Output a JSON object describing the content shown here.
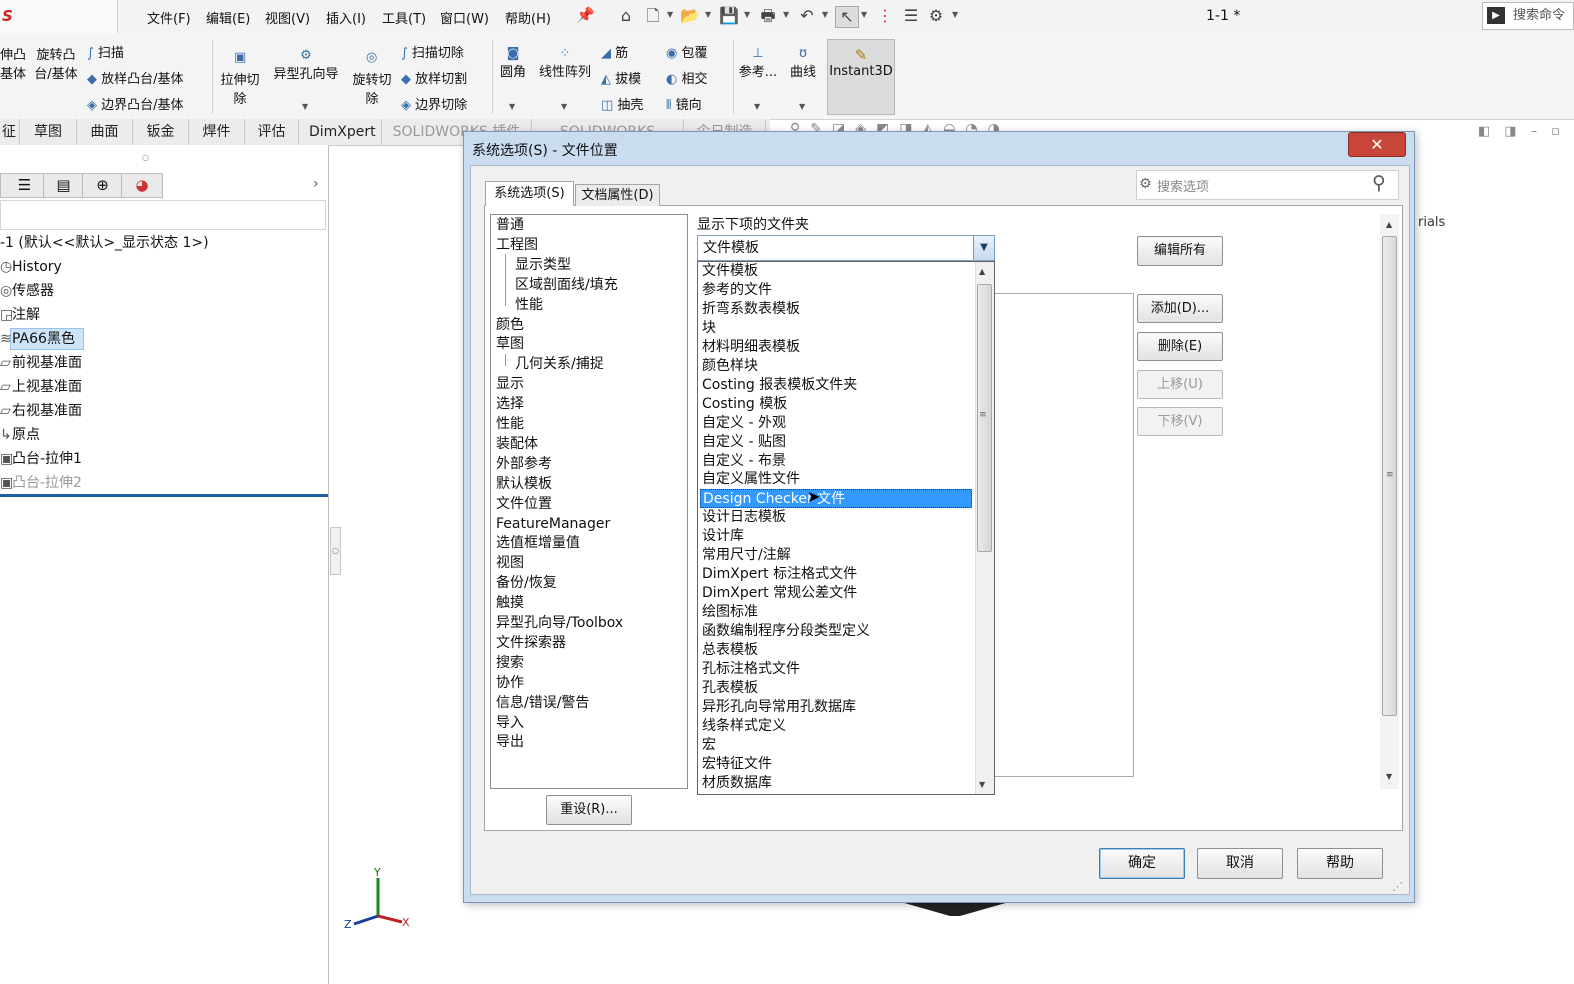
{
  "app": {
    "logo": "S SOLIDWORKS",
    "doc_title": "1-1 *",
    "search_cmd": "搜索命令"
  },
  "menu": [
    "文件(F)",
    "编辑(E)",
    "视图(V)",
    "插入(I)",
    "工具(T)",
    "窗口(W)",
    "帮助(H)"
  ],
  "ribbon": {
    "extrude_boss": "伸凸\n基体",
    "revolve_boss": "旋转凸\n台/基体",
    "sweep": "扫描",
    "loft_boss": "放样凸台/基体",
    "boundary_boss": "边界凸台/基体",
    "extruded_cut": "拉伸切\n除",
    "hole_wizard": "异型孔向导",
    "revolved_cut": "旋转切\n除",
    "swept_cut": "扫描切除",
    "lofted_cut": "放样切割",
    "boundary_cut": "边界切除",
    "fillet": "圆角",
    "linear_pattern": "线性阵列",
    "rib": "筋",
    "draft": "拔模",
    "shell": "抽壳",
    "wrap": "包覆",
    "intersect": "相交",
    "mirror": "镜向",
    "reference": "参考...",
    "curves": "曲线",
    "instant3d": "Instant3D"
  },
  "cm_tabs": [
    "征",
    "草图",
    "曲面",
    "钣金",
    "焊件",
    "评估",
    "DimXpert",
    "SOLIDWORKS 插件",
    "SOLIDWORKS MBD",
    "企日制造"
  ],
  "feature_tree": {
    "root": "-1  (默认<<默认>_显示状态 1>)",
    "items": [
      "History",
      "传感器",
      "注解",
      "PA66黑色",
      "前视基准面",
      "上视基准面",
      "右视基准面",
      "原点",
      "凸台-拉伸1",
      "凸台-拉伸2"
    ]
  },
  "graphics": {
    "partial_text": "rials",
    "axis_x": "X",
    "axis_y": "Y",
    "axis_z": "Z"
  },
  "dialog": {
    "title": "系统选项(S) - 文件位置",
    "close": "✕",
    "tab_system": "系统选项(S)",
    "tab_document": "文档属性(D)",
    "search_placeholder": "搜索选项",
    "nav": [
      {
        "label": "普通",
        "sub": false
      },
      {
        "label": "工程图",
        "sub": false
      },
      {
        "label": "显示类型",
        "sub": true
      },
      {
        "label": "区域剖面线/填充",
        "sub": true
      },
      {
        "label": "性能",
        "sub": true
      },
      {
        "label": "颜色",
        "sub": false
      },
      {
        "label": "草图",
        "sub": false
      },
      {
        "label": "几何关系/捕捉",
        "sub": true
      },
      {
        "label": "显示",
        "sub": false
      },
      {
        "label": "选择",
        "sub": false
      },
      {
        "label": "性能",
        "sub": false
      },
      {
        "label": "装配体",
        "sub": false
      },
      {
        "label": "外部参考",
        "sub": false
      },
      {
        "label": "默认模板",
        "sub": false
      },
      {
        "label": "文件位置",
        "sub": false
      },
      {
        "label": "FeatureManager",
        "sub": false
      },
      {
        "label": "选值框增量值",
        "sub": false
      },
      {
        "label": "视图",
        "sub": false
      },
      {
        "label": "备份/恢复",
        "sub": false
      },
      {
        "label": "触摸",
        "sub": false
      },
      {
        "label": "异型孔向导/Toolbox",
        "sub": false
      },
      {
        "label": "文件探索器",
        "sub": false
      },
      {
        "label": "搜索",
        "sub": false
      },
      {
        "label": "协作",
        "sub": false
      },
      {
        "label": "信息/错误/警告",
        "sub": false
      },
      {
        "label": "导入",
        "sub": false
      },
      {
        "label": "导出",
        "sub": false
      }
    ],
    "reset": "重设(R)...",
    "folders_label": "显示下项的文件夹",
    "combo_value": "文件模板",
    "dropdown_options": [
      "文件模板",
      "参考的文件",
      "折弯系数表模板",
      "块",
      "材料明细表模板",
      "颜色样块",
      "Costing 报表模板文件夹",
      "Costing 模板",
      "自定义 - 外观",
      "自定义 - 贴图",
      "自定义 - 布景",
      "自定义属性文件",
      "Design Checker 文件",
      "设计日志模板",
      "设计库",
      "常用尺寸/注解",
      "DimXpert 标注格式文件",
      "DimXpert 常规公差文件",
      "绘图标准",
      "函数编制程序分段类型定义",
      "总表模板",
      "孔标注格式文件",
      "孔表模板",
      "异形孔向导常用孔数据库",
      "线条样式定义",
      "宏",
      "宏特征文件",
      "材质数据库"
    ],
    "selected_option": "Design Checker 文件",
    "edit_all": "编辑所有",
    "add": "添加(D)...",
    "delete": "删除(E)",
    "move_up": "上移(U)",
    "move_down": "下移(V)",
    "ok": "确定",
    "cancel": "取消",
    "help": "帮助"
  }
}
